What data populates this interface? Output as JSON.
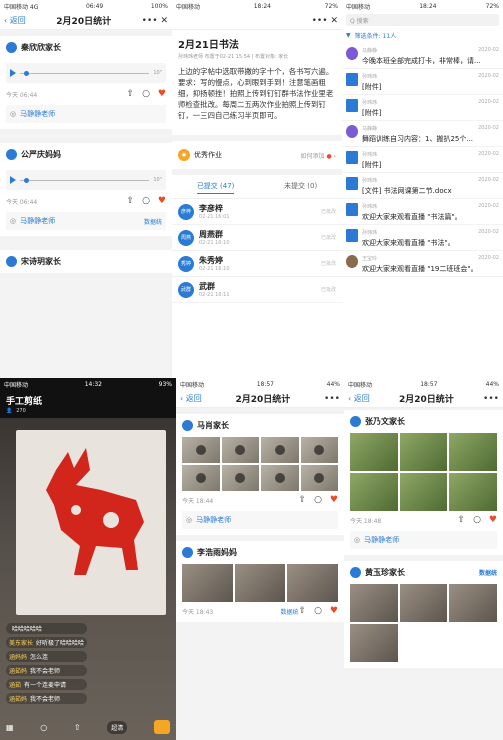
{
  "p1": {
    "status": {
      "carrier": "中国移动 4G",
      "time": "06:49",
      "right": "100%"
    },
    "nav": {
      "back": "返回",
      "title": "2月20日统计",
      "more": "•••",
      "close": "✕"
    },
    "cards": [
      {
        "name": "秦欣欣家长",
        "duration": "10\"",
        "time": "今天 06:44",
        "teacher": "马静静老师"
      },
      {
        "name": "公严庆妈妈",
        "duration": "10\"",
        "time": "今天 06:44",
        "teacher": "马静静老师",
        "datasrc": "数据统"
      },
      {
        "name": "宋诗玥家长"
      }
    ]
  },
  "p2": {
    "status": {
      "carrier": "中国移动",
      "time": "18:24",
      "right": "72%"
    },
    "nav": {
      "more": "•••",
      "close": "✕"
    },
    "title": "2月21日书法",
    "sub": "孙玮玮老师 布置于02-21 15:54 | 布置对象: 家长",
    "body": "上边的字帖中选取带撇的字十个，各书写六遍。要求：写的慢点，心到眼到手到！注意笔画粗细，抑扬顿挫！拍照上传到钉钉群书法作业里老师检查批改。每周二五两次作业拍照上传到钉钉，一三四自己练习半页即可。",
    "excellent": "优秀作业",
    "howto": "如何添加",
    "tab_done": "已提交 (47)",
    "tab_undone": "未提交 (0)",
    "students": [
      {
        "avatar": "彦梓",
        "name": "李彦梓",
        "time": "02-21 16:01",
        "status": "已批改"
      },
      {
        "avatar": "周燕",
        "name": "周燕群",
        "time": "02-21 16:10",
        "status": "已批改"
      },
      {
        "avatar": "秀婷",
        "name": "朱秀婷",
        "time": "02-21 16:10",
        "status": "已批改"
      },
      {
        "avatar": "武群",
        "name": "武群",
        "time": "02-21 16:11",
        "status": "已批改"
      }
    ]
  },
  "p3": {
    "status": {
      "carrier": "中国移动",
      "time": "18:24",
      "right": "72%"
    },
    "search": "Q 搜索",
    "filter": "筛选条件:  11人",
    "messages": [
      {
        "from": "马静静",
        "date": "2020-02",
        "text": "今晚本班全部完成打卡，非常棒，请..."
      },
      {
        "from": "孙玮玮",
        "date": "2020-02",
        "text": "[附件]"
      },
      {
        "from": "孙玮玮",
        "date": "2020-02",
        "text": "[附件]"
      },
      {
        "from": "马静静",
        "date": "2020-02",
        "text": "舞蹈训练自习内容：1、搬扒25个..."
      },
      {
        "from": "孙玮玮",
        "date": "2020-02",
        "text": "[附件]"
      },
      {
        "from": "孙玮玮",
        "date": "2020-02",
        "text": "[文件] 书法网课第二节.docx"
      },
      {
        "from": "孙玮玮",
        "date": "2020-02",
        "text": "欢迎大家来观看直播 \"书法篇\"。"
      },
      {
        "from": "孙玮玮",
        "date": "2020-02",
        "text": "欢迎大家来观看直播 \"书法\"。"
      },
      {
        "from": "王宝玲",
        "date": "2020-02",
        "text": "欢迎大家来观看直播 \"19二班班会\"。"
      }
    ]
  },
  "p4": {
    "status": {
      "carrier": "中国移动",
      "time": "14:32",
      "right": "93%"
    },
    "title": "手工剪纸",
    "viewers": "270",
    "chat": [
      {
        "name": "",
        "text": "哈哈哈哈哈"
      },
      {
        "name": "美东家长",
        "text": "好听极了哈哈哈哈"
      },
      {
        "name": "涵妈妈",
        "text": "怎么连"
      },
      {
        "name": "涵茹妈",
        "text": "我不会老师"
      },
      {
        "name": "涵茹",
        "text": "有一个连麦申请"
      },
      {
        "name": "涵茹妈",
        "text": "我不会老师"
      }
    ],
    "quality": "超清"
  },
  "p5": {
    "status": {
      "carrier": "中国移动",
      "time": "18:57",
      "right": "44%"
    },
    "nav": {
      "back": "返回",
      "title": "2月20日统计",
      "more": "•••"
    },
    "cards": [
      {
        "name": "马肖家长",
        "time": "今天 18:44",
        "teacher": "马静静老师"
      },
      {
        "name": "李浩雨妈妈",
        "time": "今天 18:43",
        "datasrc": "数据统"
      }
    ]
  },
  "p6": {
    "status": {
      "carrier": "中国移动",
      "time": "18:57",
      "right": "44%"
    },
    "nav": {
      "back": "返回",
      "title": "2月20日统计",
      "more": "•••"
    },
    "cards": [
      {
        "name": "张乃文家长",
        "time": "今天 18:48",
        "teacher": "马静静老师"
      },
      {
        "name": "黄玉珍家长",
        "datasrc": "数据统"
      }
    ]
  }
}
